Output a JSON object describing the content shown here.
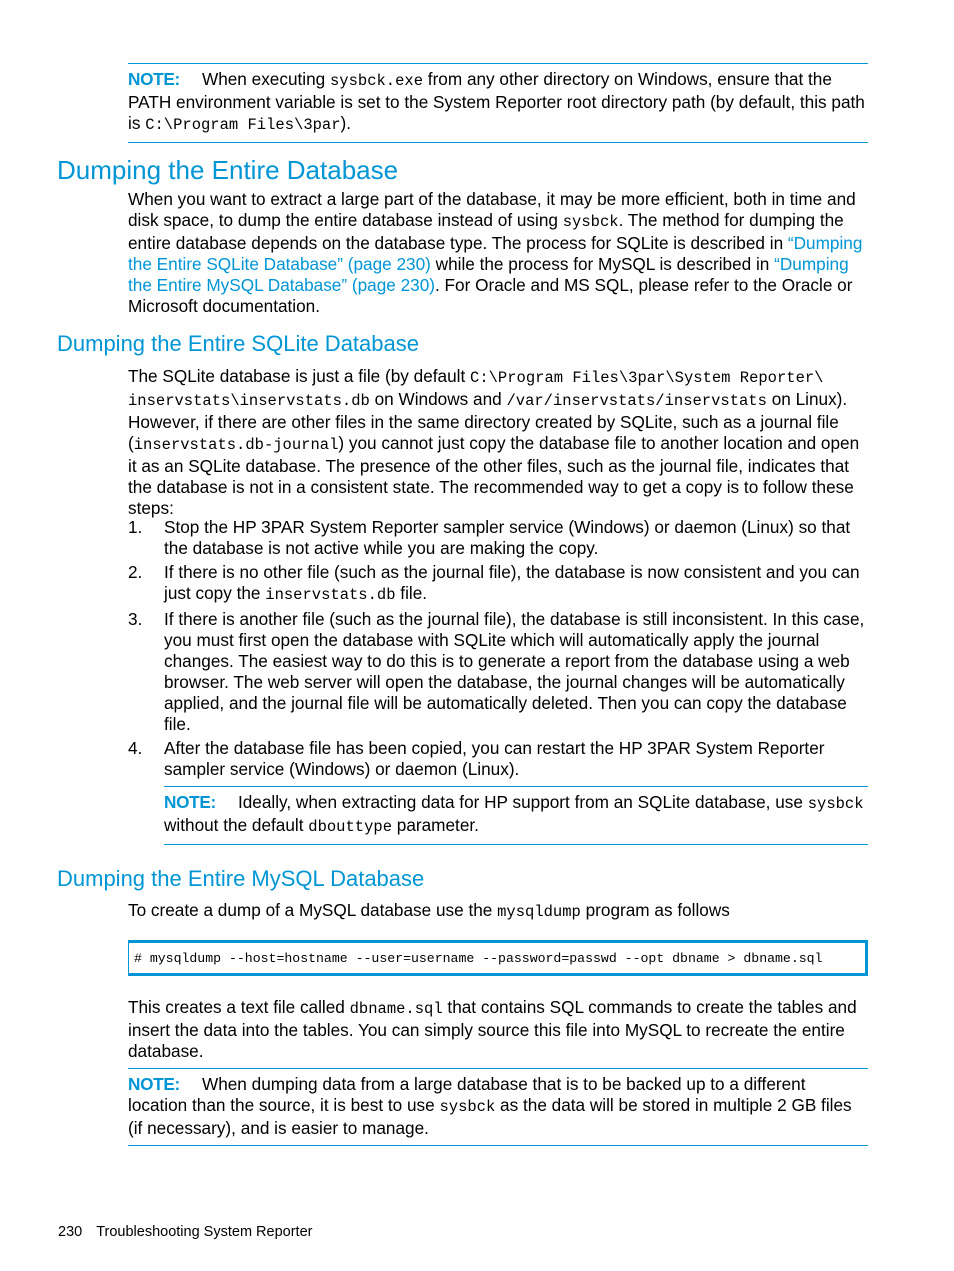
{
  "note_top": {
    "label": "NOTE:",
    "t1": "When executing ",
    "c1": "sysbck.exe",
    "t2": " from any other directory on Windows, ensure that the PATH environment variable is set to the System Reporter root directory path (by default, this path is ",
    "c2": "C:\\Program Files\\3par",
    "t3": ")."
  },
  "section1": {
    "title": "Dumping the Entire Database",
    "p_t1": "When you want to extract a large part of the database, it may be more efficient, both in time and disk space, to dump the entire database instead of using ",
    "p_c1": "sysbck",
    "p_t2": ". The method for dumping the entire database depends on the database type. The process for SQLite is described in ",
    "link1": "“Dumping the Entire SQLite Database” (page 230)",
    "p_t3": " while the process for MySQL is described in ",
    "link2": "“Dumping the Entire MySQL Database” (page 230)",
    "p_t4": ". For Oracle and MS SQL, please refer to the Oracle or Microsoft documentation."
  },
  "section2": {
    "title": "Dumping the Entire SQLite Database",
    "p_t1": "The SQLite database is just a file (by default ",
    "p_c1": "C:\\Program Files\\3par\\System Reporter\\ inservstats\\inservstats.db",
    "p_t2": " on Windows and ",
    "p_c2": "/var/inservstats/inservstats",
    "p_t3": " on Linux). However, if there are other files in the same directory created by SQLite, such as a journal file (",
    "p_c3": "inservstats.db-journal",
    "p_t4": ") you cannot just copy the database file to another location and open it as an SQLite database. The presence of the other files, such as the journal file, indicates that the database is not in a consistent state. The recommended way to get a copy is to follow these steps:",
    "steps": [
      {
        "num": "1.",
        "t1": "Stop the HP 3PAR System Reporter sampler service (Windows) or daemon (Linux) so that the database is not active while you are making the copy.",
        "c1": "",
        "t2": ""
      },
      {
        "num": "2.",
        "t1": "If there is no other file (such as the journal file), the database is now consistent and you can just copy the ",
        "c1": "inservstats.db",
        "t2": " file."
      },
      {
        "num": "3.",
        "t1": "If there is another file (such as the journal file), the database is still inconsistent. In this case, you must first open the database with SQLite which will automatically apply the journal changes. The easiest way to do this is to generate a report from the database using a web browser. The web server will open the database, the journal changes will be automatically applied, and the journal file will be automatically deleted. Then you can copy the database file.",
        "c1": "",
        "t2": ""
      },
      {
        "num": "4.",
        "t1": "After the database file has been copied, you can restart the HP 3PAR System Reporter sampler service (Windows) or daemon (Linux).",
        "c1": "",
        "t2": ""
      }
    ],
    "note": {
      "label": "NOTE:",
      "t1": "Ideally, when extracting data for HP support from an SQLite database, use ",
      "c1": "sysbck",
      "t2": " without the default ",
      "c2": "dbouttype",
      "t3": " parameter."
    }
  },
  "section3": {
    "title": "Dumping the Entire MySQL Database",
    "p_t1": "To create a dump of a MySQL database use the ",
    "p_c1": "mysqldump",
    "p_t2": " program as follows",
    "code": "# mysqldump --host=hostname --user=username --password=passwd --opt dbname > dbname.sql",
    "p2_t1": "This creates a text file called ",
    "p2_c1": "dbname.sql",
    "p2_t2": " that contains SQL commands to create the tables and insert the data into the tables. You can simply source this file into MySQL to recreate the entire database.",
    "note": {
      "label": "NOTE:",
      "t1": "When dumping data from a large database that is to be backed up to a different location than the source, it is best to use ",
      "c1": "sysbck",
      "t2": " as the data will be stored in multiple 2 GB files (if necessary), and is easier to manage."
    }
  },
  "footer": {
    "page_number": "230",
    "chapter": "Troubleshooting System Reporter"
  }
}
